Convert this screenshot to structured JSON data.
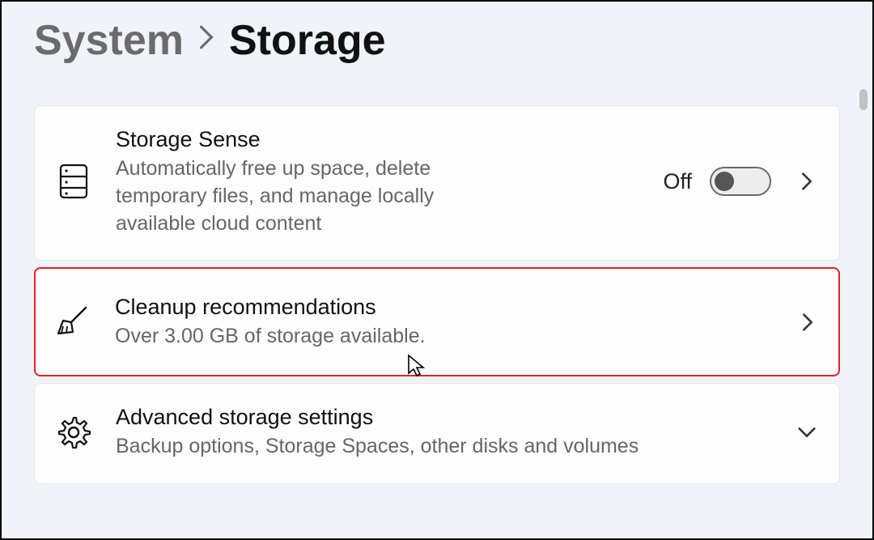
{
  "breadcrumb": {
    "parent": "System",
    "current": "Storage"
  },
  "cards": {
    "storageSense": {
      "title": "Storage Sense",
      "desc": "Automatically free up space, delete temporary files, and manage locally available cloud content",
      "toggleState": "Off"
    },
    "cleanup": {
      "title": "Cleanup recommendations",
      "desc": "Over 3.00 GB of storage available."
    },
    "advanced": {
      "title": "Advanced storage settings",
      "desc": "Backup options, Storage Spaces, other disks and volumes"
    }
  }
}
